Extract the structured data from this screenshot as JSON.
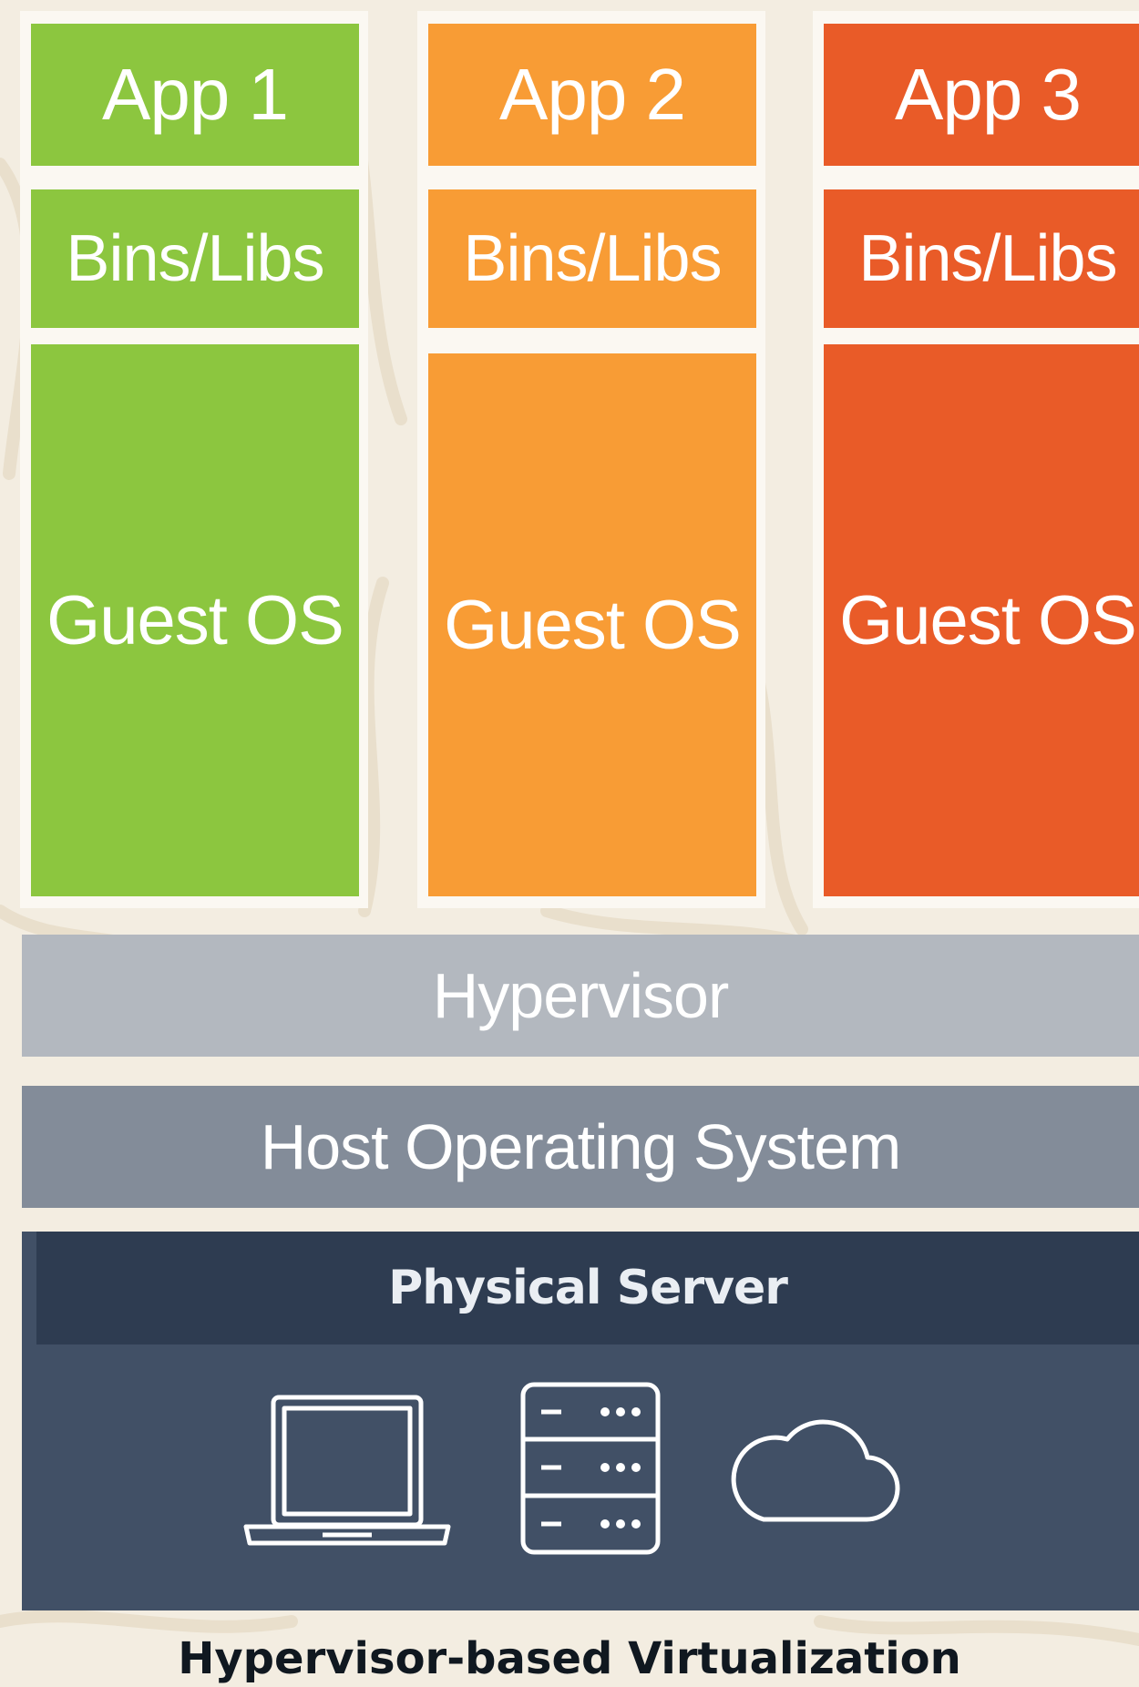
{
  "diagram": {
    "caption": "Hypervisor-based Virtualization",
    "virtual_machines": [
      {
        "app": "App 1",
        "libs": "Bins/Libs",
        "os": "Guest OS",
        "color": "#8cc63f"
      },
      {
        "app": "App 2",
        "libs": "Bins/Libs",
        "os": "Guest OS",
        "color": "#f89c35"
      },
      {
        "app": "App 3",
        "libs": "Bins/Libs",
        "os": "Guest OS",
        "color": "#e95b28"
      }
    ],
    "hypervisor": {
      "label": "Hypervisor",
      "color": "#b3b8bf"
    },
    "host_os": {
      "label": "Host Operating System",
      "color": "#838c99"
    },
    "physical_server": {
      "label": "Physical Server",
      "header_color": "#2e3c51",
      "body_color": "#415066",
      "icons": [
        "laptop-icon",
        "server-rack-icon",
        "cloud-icon"
      ]
    },
    "background_color": "#f3ede1"
  }
}
